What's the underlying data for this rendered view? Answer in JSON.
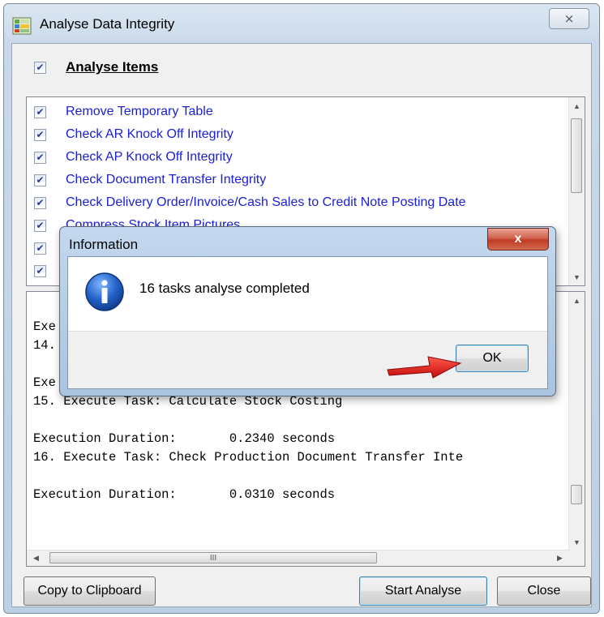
{
  "window": {
    "title": "Analyse Data Integrity",
    "close_glyph": "⨯",
    "icon": "grid-app-icon"
  },
  "analyse_items": {
    "label": "Analyse Items",
    "checked": true
  },
  "items": [
    {
      "label": "Remove Temporary Table",
      "checked": true
    },
    {
      "label": "Check AR Knock Off Integrity",
      "checked": true
    },
    {
      "label": "Check AP Knock Off Integrity",
      "checked": true
    },
    {
      "label": "Check Document Transfer Integrity",
      "checked": true
    },
    {
      "label": "Check Delivery Order/Invoice/Cash Sales to Credit Note Posting Date",
      "checked": true
    },
    {
      "label": "Compress Stock Item Pictures",
      "checked": true
    },
    {
      "label": "",
      "checked": true
    },
    {
      "label": "",
      "checked": true
    }
  ],
  "log": {
    "lines": [
      "Exe",
      "14.",
      "",
      "Exe",
      "15. Execute Task: Calculate Stock Costing",
      "",
      "Execution Duration:       0.2340 seconds",
      "16. Execute Task: Check Production Document Transfer Inte",
      "",
      "Execution Duration:       0.0310 seconds"
    ],
    "hscroll_grip": "III"
  },
  "buttons": {
    "copy": "Copy to Clipboard",
    "start": "Start Analyse",
    "close": "Close"
  },
  "dialog": {
    "title": "Information",
    "close_glyph": "x",
    "message": "16 tasks analyse completed",
    "ok": "OK",
    "icon": "info-icon"
  },
  "colors": {
    "item_text": "#1b20d4",
    "arrow": "#e01010"
  }
}
